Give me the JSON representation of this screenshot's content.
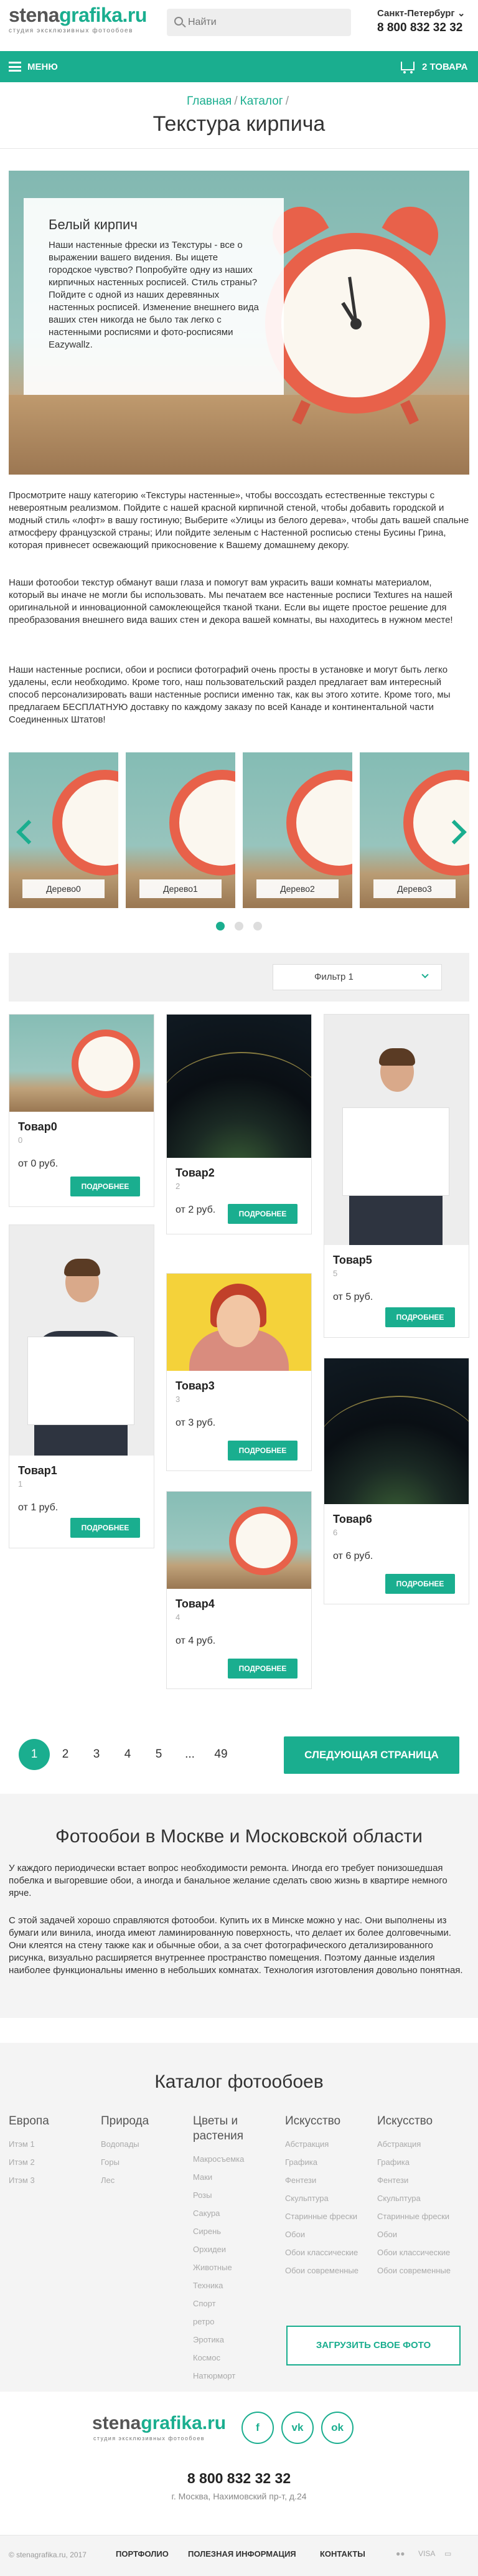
{
  "header": {
    "logo_a": "stena",
    "logo_b": "grafika.ru",
    "tagline": "студия эксклюзивных фотообоев",
    "search_placeholder": "Найти",
    "city": "Санкт-Петербург ⌄",
    "phone": "8 800 832 32 32",
    "menu_label": "МЕНЮ",
    "cart_label": "2 ТОВАРА"
  },
  "breadcrumb": {
    "home": "Главная",
    "catalog": "Каталог"
  },
  "page_title": "Текстура кирпича",
  "hero": {
    "title": "Белый кирпич",
    "text": "Наши настенные фрески из Текстуры - все о выражении вашего видения. Вы ищете городское чувство? Попробуйте одну из наших кирпичных настенных росписей. Стиль страны? Пойдите с одной из наших деревянных настенных росписей. Изменение внешнего вида ваших стен никогда не было так легко с настенными росписями и фото-росписями Eazywallz."
  },
  "paragraphs": [
    "Просмотрите нашу категорию «Текстуры настенные», чтобы воссоздать естественные текстуры с невероятным реализмом. Пойдите с нашей красной кирпичной стеной, чтобы добавить городской и модный стиль «лофт» в вашу гостиную; Выберите «Улицы из белого дерева», чтобы дать вашей спальне атмосферу французской страны; Или пойдите зеленым с Настенной росписью стены Бусины Грина, которая привнесет освежающий прикосновение к Вашему домашнему декору.",
    "Наши фотообои текстур обманут ваши глаза и помогут вам украсить ваши комнаты материалом, который вы иначе не могли бы использовать. Мы печатаем все настенные росписи Textures на нашей оригинальной и инновационной самоклеющейся тканой ткани. Если вы ищете простое решение для преобразования внешнего вида ваших стен и декора вашей комнаты, вы находитесь в нужном месте!",
    "Наши настенные росписи, обои и росписи фотографий очень просты в установке и могут быть легко удалены, если необходимо. Кроме того, наш пользовательский раздел предлагает вам интересный способ персонализировать ваши настенные росписи именно так, как вы этого хотите. Кроме того, мы предлагаем БЕСПЛАТНУЮ доставку по каждому заказу по всей Канаде и континентальной части Соединенных Штатов!"
  ],
  "slider": {
    "captions": [
      "Дерево0",
      "Дерево1",
      "Дерево2",
      "Дерево3"
    ],
    "active_dot": 1,
    "dots": 3
  },
  "filter": {
    "label": "Фильтр 1"
  },
  "products": [
    {
      "name": "Товар0",
      "num": "0",
      "price": "от 0 руб.",
      "btn": "ПОДРОБНЕЕ"
    },
    {
      "name": "Товар1",
      "num": "1",
      "price": "от 1 руб.",
      "btn": "ПОДРОБНЕЕ"
    },
    {
      "name": "Товар2",
      "num": "2",
      "price": "от 2 руб.",
      "btn": "ПОДРОБНЕЕ"
    },
    {
      "name": "Товар3",
      "num": "3",
      "price": "от 3 руб.",
      "btn": "ПОДРОБНЕЕ"
    },
    {
      "name": "Товар4",
      "num": "4",
      "price": "от 4 руб.",
      "btn": "ПОДРОБНЕЕ"
    },
    {
      "name": "Товар5",
      "num": "5",
      "price": "от 5 руб.",
      "btn": "ПОДРОБНЕЕ"
    },
    {
      "name": "Товар6",
      "num": "6",
      "price": "от 6 руб.",
      "btn": "ПОДРОБНЕЕ"
    }
  ],
  "pager": {
    "pages": [
      "1",
      "2",
      "3",
      "4",
      "5",
      "...",
      "49"
    ],
    "current": "1",
    "next_label": "СЛЕДУЮЩАЯ СТРАНИЦА"
  },
  "seo": {
    "title": "Фотообои в Москве и Московской области",
    "p1": "У каждого периодически встает вопрос необходимости ремонта. Иногда его требует понизошедшая побелка и выгоревшие обои, а иногда и банальное желание сделать свою жизнь в квартире немного ярче.",
    "p2": "С этой задачей хорошо справляются фотообои. Купить их в Минске можно у нас. Они выполнены из бумаги или винила, иногда имеют ламинированную поверхность, что делает их более долговечными. Они клеятся на стену также как и обычные обои, а за счет фотографического детализированного рисунка, визуально расширяется внутреннее пространство помещения. Поэтому данные изделия наиболее функциональны именно в небольших комнатах. Технология изготовления довольно понятная."
  },
  "catalog": {
    "title": "Каталог фотообоев",
    "columns": [
      {
        "title": "Европа",
        "items": [
          "Итэм 1",
          "Итэм 2",
          "Итэм 3"
        ]
      },
      {
        "title": "Природа",
        "items": [
          "Водопады",
          "Горы",
          "Лес"
        ]
      },
      {
        "title": "Цветы и растения",
        "items": [
          "Макросъемка",
          "Маки",
          "Розы",
          "Сакура",
          "Сирень",
          "Орхидеи",
          "Животные",
          "Техника",
          "Спорт",
          "ретро",
          "Эротика",
          "Космос",
          "Натюрморт"
        ]
      },
      {
        "title": "Искусство",
        "items": [
          "Абстракция",
          "Графика",
          "Фентези",
          "Скульптура",
          "Старинные фрески",
          "Обои",
          "Обои классические",
          "Обои современные"
        ]
      },
      {
        "title": "Искусство",
        "items": [
          "Абстракция",
          "Графика",
          "Фентези",
          "Скульптура",
          "Старинные фрески",
          "Обои",
          "Обои классические",
          "Обои современные"
        ]
      }
    ],
    "upload_label": "ЗАГРУЗИТЬ СВОЕ ФОТО"
  },
  "footer": {
    "logo_a": "stena",
    "logo_b": "grafika.ru",
    "tagline": "студия эксклюзивных фотообоев",
    "social": [
      "f",
      "vk",
      "ok"
    ],
    "phone": "8 800 832 32 32",
    "address": "г. Москва, Нахимовский пр-т, д.24",
    "copyright": "© stenagrafika.ru, 2017",
    "links": [
      "ПОРТФОЛИО",
      "ПОЛЕЗНАЯ ИНФОРМАЦИЯ",
      "КОНТАКТЫ"
    ],
    "pay": [
      "●●",
      "VISA",
      "▭"
    ]
  },
  "colors": {
    "accent": "#1aae8f",
    "text": "#333333",
    "muted": "#aaaaaa",
    "panel": "#f4f4f4"
  }
}
